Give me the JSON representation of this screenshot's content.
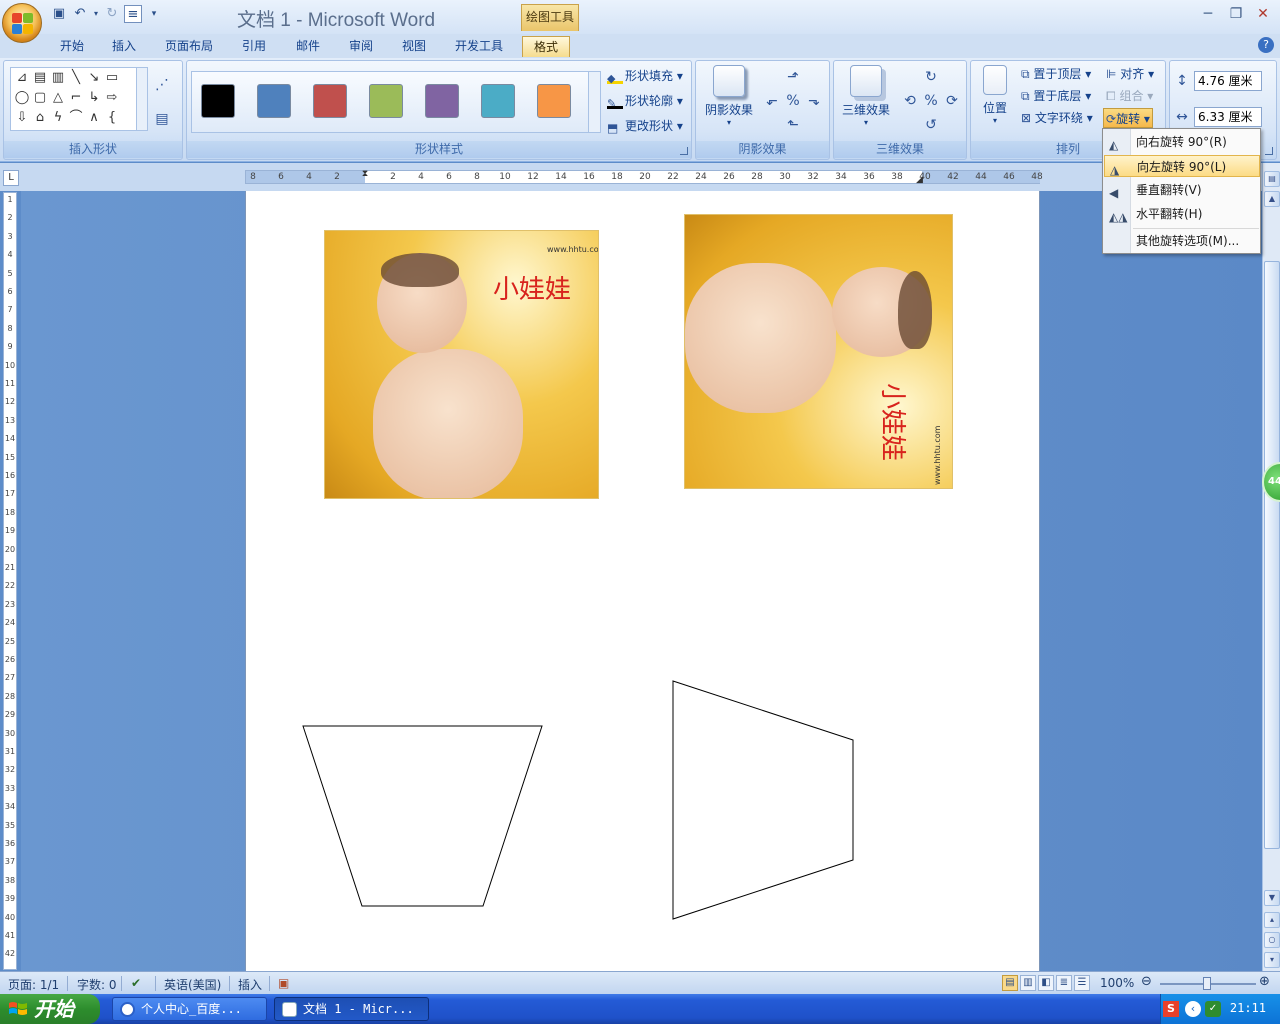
{
  "window": {
    "title": "文档 1 - Microsoft Word",
    "context_tab_group": "绘图工具"
  },
  "qat": {
    "save": "save-icon",
    "undo": "undo-icon",
    "redo": "redo-icon",
    "customize": "customize-icon"
  },
  "tabs": [
    {
      "label": "开始"
    },
    {
      "label": "插入"
    },
    {
      "label": "页面布局"
    },
    {
      "label": "引用"
    },
    {
      "label": "邮件"
    },
    {
      "label": "审阅"
    },
    {
      "label": "视图"
    },
    {
      "label": "开发工具"
    },
    {
      "label": "格式",
      "active": true
    }
  ],
  "ribbon": {
    "insert_shapes": {
      "label": "插入形状"
    },
    "shape_styles": {
      "label": "形状样式",
      "swatches": [
        "#000000",
        "#4f81bd",
        "#c0504d",
        "#9bbb59",
        "#8064a2",
        "#4bacc6",
        "#f79646"
      ],
      "fill": "形状填充",
      "outline": "形状轮廓",
      "change": "更改形状"
    },
    "shadow": {
      "label": "阴影效果",
      "button": "阴影效果"
    },
    "three_d": {
      "label": "三维效果",
      "button": "三维效果"
    },
    "arrange": {
      "label": "排列",
      "position": "位置",
      "bring_front": "置于顶层",
      "send_back": "置于底层",
      "text_wrap": "文字环绕",
      "align": "对齐",
      "group": "组合",
      "rotate": "旋转"
    },
    "size": {
      "height": "4.76 厘米",
      "width": "6.33 厘米"
    }
  },
  "rotate_menu": [
    {
      "label": "向右旋转 90°(R)",
      "icon": "rotate-right-icon"
    },
    {
      "label": "向左旋转 90°(L)",
      "icon": "rotate-left-icon",
      "hover": true
    },
    {
      "label": "垂直翻转(V)",
      "icon": "flip-vertical-icon"
    },
    {
      "label": "水平翻转(H)",
      "icon": "flip-horizontal-icon"
    },
    {
      "label": "其他旋转选项(M)..."
    }
  ],
  "ruler": {
    "h_left": [
      "8",
      "6",
      "4",
      "2"
    ],
    "h_right": [
      "2",
      "4",
      "6",
      "8",
      "10",
      "12",
      "14",
      "16",
      "18",
      "20",
      "22",
      "24",
      "26",
      "28",
      "30",
      "32",
      "34",
      "36",
      "38",
      "40",
      "42",
      "44",
      "46",
      "48"
    ],
    "corner": "L"
  },
  "document": {
    "photo1": {
      "title": "小娃娃",
      "mark": "www.hhtu.com"
    },
    "photo2": {
      "title": "小娃娃",
      "mark": "www.hhtu.com",
      "rotation_deg": -90
    },
    "float_badge": "44"
  },
  "status": {
    "page": "页面: 1/1",
    "words": "字数: 0",
    "language": "英语(美国)",
    "mode": "插入",
    "zoom": "100%"
  },
  "taskbar": {
    "start": "开始",
    "items": [
      {
        "label": "个人中心_百度...",
        "icon": "browser-icon"
      },
      {
        "label": "文档 1 - Micr...",
        "icon": "word-icon",
        "active": true
      }
    ],
    "clock": "21:11"
  },
  "colors": {
    "accent": "#f5c14d",
    "ribbon": "#d7e5f7",
    "taskbar": "#245bd6"
  }
}
